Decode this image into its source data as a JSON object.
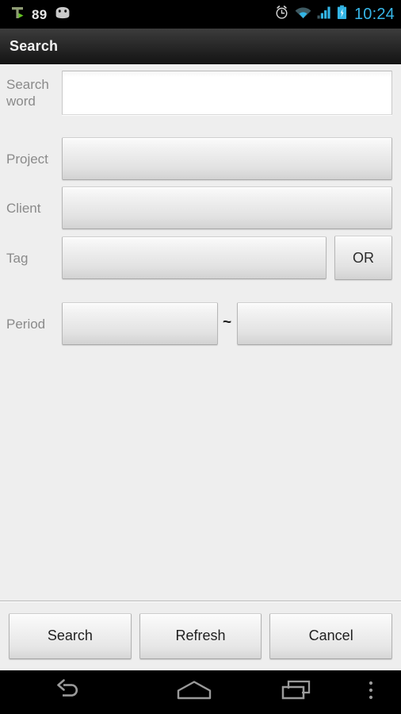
{
  "status_bar": {
    "app_icon": "t-logo-icon",
    "notification_count": "89",
    "android_icon": "android-robot-icon",
    "alarm_icon": "alarm-clock-icon",
    "wifi_icon": "wifi-icon",
    "signal_icon": "signal-bars-icon",
    "battery_icon": "battery-charging-icon",
    "clock": "10:24",
    "clock_color": "#37b6e8",
    "background": "#000000"
  },
  "action_bar": {
    "title": "Search",
    "background": "#2a2a2a",
    "title_color": "#f2f2f2"
  },
  "form": {
    "rows": [
      {
        "label": "Search word",
        "type": "edittext",
        "value": "",
        "placeholder": ""
      },
      {
        "label": "Project",
        "type": "spinner",
        "value": ""
      },
      {
        "label": "Client",
        "type": "spinner",
        "value": ""
      },
      {
        "label": "Tag",
        "type": "spinner-with-button",
        "value": "",
        "button_label": "OR"
      },
      {
        "label": "Period",
        "type": "date-range",
        "from_value": "",
        "separator": "~",
        "to_value": ""
      }
    ],
    "background": "#eeeeee",
    "label_color": "#8a8a8a"
  },
  "button_bar": {
    "buttons": [
      {
        "label": "Search"
      },
      {
        "label": "Refresh"
      },
      {
        "label": "Cancel"
      }
    ]
  },
  "nav_bar": {
    "back_icon": "back-arrow-icon",
    "home_icon": "home-icon",
    "recents_icon": "recent-apps-icon",
    "menu_icon": "overflow-menu-icon",
    "background": "#000000"
  }
}
